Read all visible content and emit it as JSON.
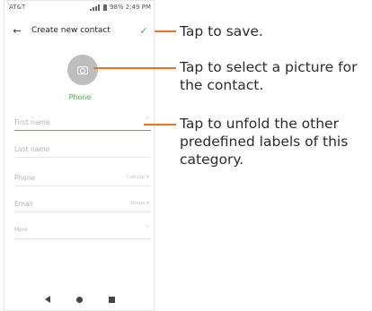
{
  "status_bar": {
    "carrier": "AT&T",
    "battery_time": "98% 2:49 PM"
  },
  "app_bar": {
    "back_icon": "arrow-left-icon",
    "title": "Create new contact",
    "save_icon": "check-icon"
  },
  "photo": {
    "icon": "camera-icon",
    "account_label": "Phone"
  },
  "fields": {
    "first_name": "First name",
    "last_name": "Last name",
    "phone": "Phone",
    "phone_type": "Cellular",
    "email": "Email",
    "email_type": "Home",
    "more": "More"
  },
  "nav_bar": {
    "back": "nav-back-icon",
    "home": "nav-home-icon",
    "recent": "nav-recent-icon"
  },
  "annotations": {
    "save": "Tap to save.",
    "picture": "Tap to select a picture for the contact.",
    "unfold": "Tap to unfold the other predefined labels of this category."
  },
  "colors": {
    "accent": "#43b54b",
    "callout": "#e9742b",
    "photo_bg": "#bdbdbd"
  }
}
